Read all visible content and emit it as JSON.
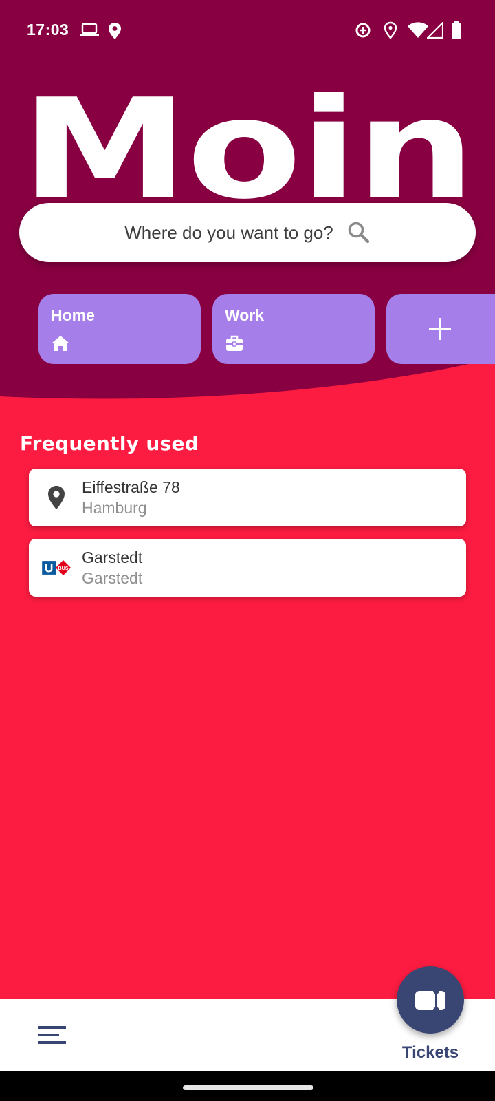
{
  "status_bar": {
    "time": "17:03",
    "left_icons": [
      "laptop-icon",
      "location-pin-icon"
    ],
    "right_icons": [
      "data-saver-icon",
      "location-outline-icon",
      "wifi-icon",
      "signal-icon",
      "battery-icon"
    ]
  },
  "hero": {
    "title": "Moin"
  },
  "search": {
    "placeholder": "Where do you want to go?",
    "icon": "search-icon"
  },
  "shortcuts": [
    {
      "label": "Home",
      "icon": "home-icon"
    },
    {
      "label": "Work",
      "icon": "briefcase-icon"
    },
    {
      "label": "",
      "icon": "plus-icon"
    }
  ],
  "frequently_used": {
    "title": "Frequently used",
    "items": [
      {
        "name": "Eiffestraße 78",
        "subtitle": "Hamburg",
        "icon": "map-pin-icon"
      },
      {
        "name": "Garstedt",
        "subtitle": "Garstedt",
        "icon": "u-bahn-bus-icon",
        "badge_text": "U",
        "badge_sub": "BUS"
      }
    ]
  },
  "bottom_bar": {
    "menu_icon": "menu-icon",
    "tickets_label": "Tickets",
    "tickets_icon": "ticket-icon"
  },
  "colors": {
    "header_bg": "#880041",
    "body_bg": "#fc1c41",
    "shortcut_bg": "#a67eea",
    "fab_bg": "#394673",
    "accent_text": "#394673"
  }
}
